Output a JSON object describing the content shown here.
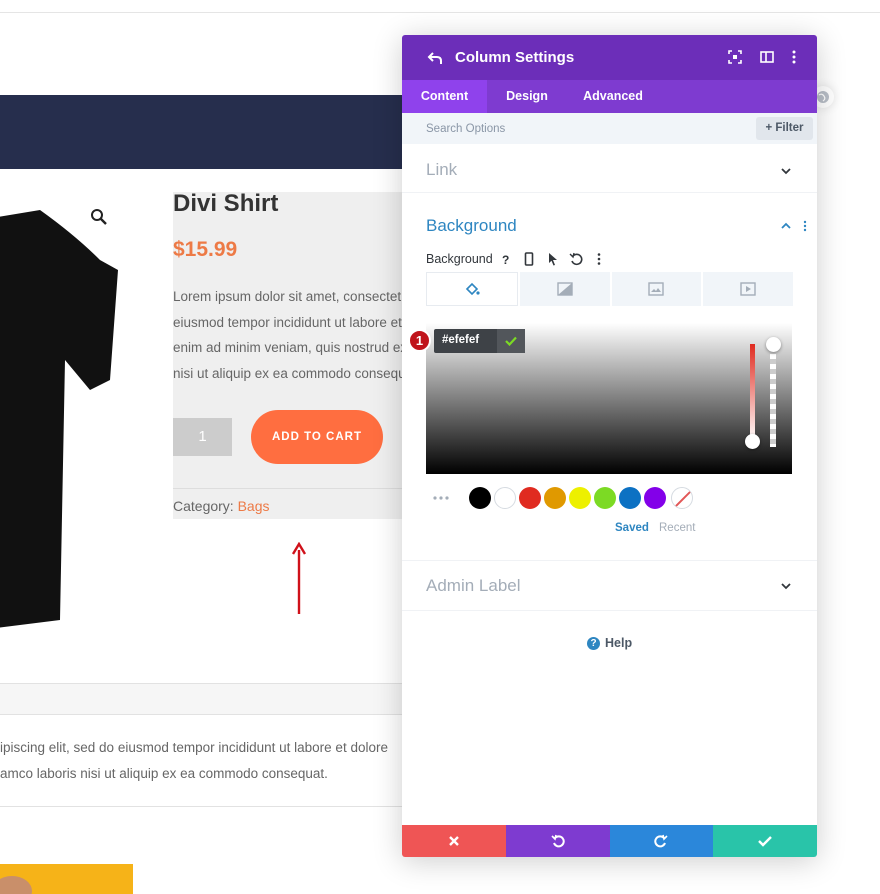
{
  "product": {
    "title": "Divi Shirt",
    "price": "$15.99",
    "description_lines": [
      "Lorem ipsum dolor sit amet, consectetur",
      "eiusmod tempor incididunt ut labore et",
      "enim ad minim veniam, quis nostrud ex",
      "nisi ut aliquip ex ea commodo consequat."
    ],
    "quantity": "1",
    "add_to_cart": "ADD TO CART",
    "category_label": "Category:",
    "category_value": "Bags"
  },
  "long_description": {
    "lines": [
      "ipiscing elit, sed do eiusmod tempor incididunt ut labore et dolore",
      "amco laboris nisi ut aliquip ex ea commodo consequat."
    ]
  },
  "modal": {
    "title": "Column Settings",
    "tabs": [
      "Content",
      "Design",
      "Advanced"
    ],
    "active_tab": "Content",
    "search": {
      "placeholder": "Search Options"
    },
    "filter_label": "Filter",
    "sections": {
      "link": "Link",
      "background": "Background",
      "admin_label": "Admin Label"
    },
    "background_label": "Background",
    "color_picker": {
      "hex_value": "#efefef",
      "step_badge": "1",
      "swatches": [
        "#000000",
        "#ffffff",
        "#e02b20",
        "#e09900",
        "#edf000",
        "#7cda24",
        "#0c71c3",
        "#8300e9"
      ],
      "saved_label": "Saved",
      "recent_label": "Recent"
    },
    "help_label": "Help",
    "footer_colors": {
      "cancel": "#ef5555",
      "undo": "#7e3bd0",
      "redo": "#2b87da",
      "save": "#29c4a9"
    }
  },
  "colors": {
    "header": "#6c2eb9",
    "tabs": "#7e3bd0",
    "accent_blue": "#2e86c1",
    "price_orange": "#ed7a46",
    "cart_button": "#ff6e40"
  }
}
